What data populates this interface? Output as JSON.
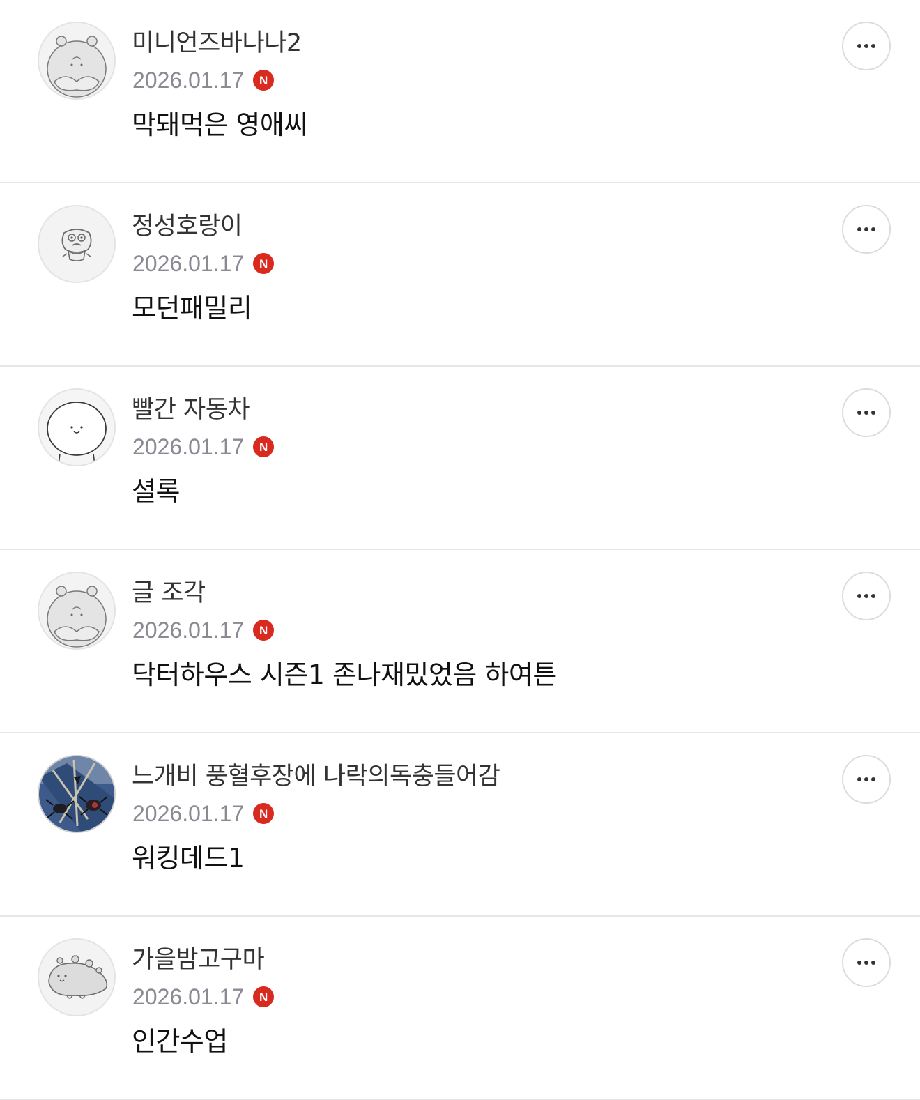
{
  "comments": [
    {
      "author": "미니언즈바나나2",
      "date": "2026.01.17",
      "badge": "N",
      "text": "막돼먹은 영애씨",
      "avatar_icon": "hamster-avatar-icon"
    },
    {
      "author": "정성호랑이",
      "date": "2026.01.17",
      "badge": "N",
      "text": "모던패밀리",
      "avatar_icon": "tiger-avatar-icon"
    },
    {
      "author": "빨간 자동차",
      "date": "2026.01.17",
      "badge": "N",
      "text": "셜록",
      "avatar_icon": "bear-avatar-icon"
    },
    {
      "author": "글 조각",
      "date": "2026.01.17",
      "badge": "N",
      "text": "닥터하우스 시즌1 존나재밌었음 하여튼",
      "avatar_icon": "hamster-avatar-icon"
    },
    {
      "author": "느개비 풍혈후장에 나락의독충들어감",
      "date": "2026.01.17",
      "badge": "N",
      "text": "워킹데드1",
      "avatar_icon": "insect-photo-avatar"
    },
    {
      "author": "가을밤고구마",
      "date": "2026.01.17",
      "badge": "N",
      "text": "인간수업",
      "avatar_icon": "dinosaur-avatar-icon"
    }
  ],
  "more_icon": "more-horizontal-icon",
  "colors": {
    "new_badge": "#d92a20",
    "date_text": "#8a8a93",
    "divider": "#e6e6e8"
  }
}
